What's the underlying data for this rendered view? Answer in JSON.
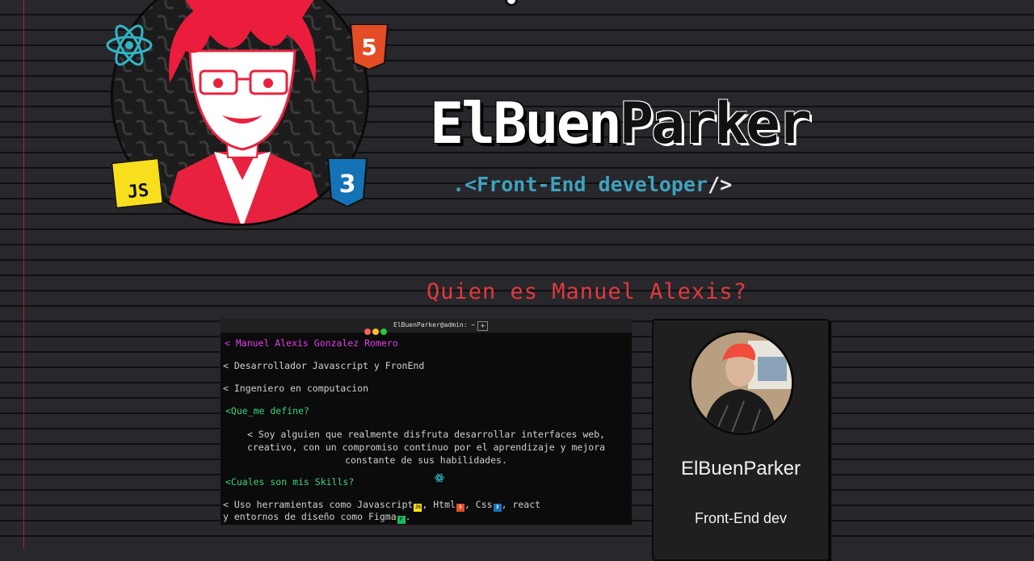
{
  "header": {
    "brand_part1": "ElBuen",
    "brand_part2": "Parker",
    "subtitle_prefix": ".<",
    "subtitle_text": "Front-End developer",
    "subtitle_suffix": "/>"
  },
  "avatar": {
    "badges": {
      "js": "JS",
      "html": "5",
      "css": "3"
    },
    "icons": [
      "react-icon",
      "html5-icon",
      "css3-icon",
      "js-icon"
    ]
  },
  "about": {
    "title": "Quien es Manuel Alexis?"
  },
  "terminal": {
    "window_title": "ElBuenParker@admin: ~",
    "new_tab": "+",
    "lines": {
      "name": "< Manuel Alexis Gonzalez Romero",
      "role": "< Desarrollador Javascript y FronEnd",
      "degree": "< Ingeniero en computacion",
      "define_heading": "<Que_me define?",
      "define_text": "< Soy alguien que realmente disfruta desarrollar interfaces web,\ncreativo, con un compromiso continuo por el aprendizaje y mejora\nconstante de sus habilidades.",
      "skills_heading": "<Cuales son mis Skills?",
      "skills_p1": "< Uso herramientas como Javascript",
      "skills_p2": ", Html",
      "skills_p3": ", Css",
      "skills_p4": ", react",
      "skills_line2": "y entornos de diseño como Figma",
      "skills_end": "."
    }
  },
  "card": {
    "name": "ElBuenParker",
    "role": "Front-End dev"
  },
  "colors": {
    "background": "#28272c",
    "accent_red": "#e03a3e",
    "accent_cyan": "#3ea3bd",
    "terminal_magenta": "#e23ce6",
    "terminal_green": "#3ad57a",
    "js_yellow": "#f7df1e",
    "html_orange": "#e44d26",
    "css_blue": "#1572b6"
  }
}
